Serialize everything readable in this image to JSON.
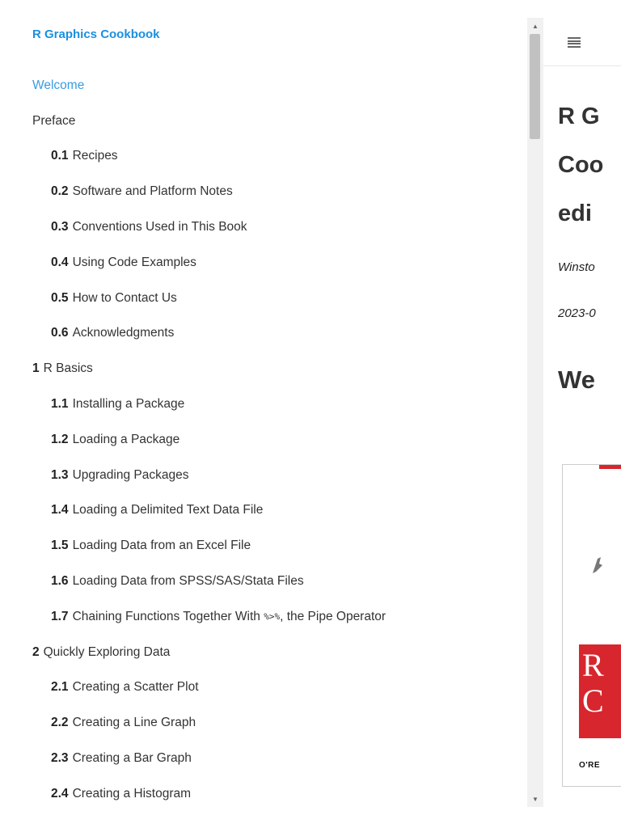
{
  "sidebar": {
    "book_title": "R Graphics Cookbook",
    "items": [
      {
        "num": "",
        "label": "Welcome",
        "level": 0,
        "active": true
      },
      {
        "num": "",
        "label": "Preface",
        "level": 0,
        "active": false
      },
      {
        "num": "0.1",
        "label": "Recipes",
        "level": 1,
        "active": false
      },
      {
        "num": "0.2",
        "label": "Software and Platform Notes",
        "level": 1,
        "active": false
      },
      {
        "num": "0.3",
        "label": "Conventions Used in This Book",
        "level": 1,
        "active": false
      },
      {
        "num": "0.4",
        "label": "Using Code Examples",
        "level": 1,
        "active": false
      },
      {
        "num": "0.5",
        "label": "How to Contact Us",
        "level": 1,
        "active": false
      },
      {
        "num": "0.6",
        "label": "Acknowledgments",
        "level": 1,
        "active": false
      },
      {
        "num": "1",
        "label": "R Basics",
        "level": 0,
        "active": false
      },
      {
        "num": "1.1",
        "label": "Installing a Package",
        "level": 1,
        "active": false
      },
      {
        "num": "1.2",
        "label": "Loading a Package",
        "level": 1,
        "active": false
      },
      {
        "num": "1.3",
        "label": "Upgrading Packages",
        "level": 1,
        "active": false
      },
      {
        "num": "1.4",
        "label": "Loading a Delimited Text Data File",
        "level": 1,
        "active": false
      },
      {
        "num": "1.5",
        "label": "Loading Data from an Excel File",
        "level": 1,
        "active": false
      },
      {
        "num": "1.6",
        "label": "Loading Data from SPSS/SAS/Stata Files",
        "level": 1,
        "active": false
      },
      {
        "num": "1.7",
        "label": "Chaining Functions Together With ",
        "code": "%>%",
        "label_after": ", the Pipe Operator",
        "level": 1,
        "active": false
      },
      {
        "num": "2",
        "label": "Quickly Exploring Data",
        "level": 0,
        "active": false
      },
      {
        "num": "2.1",
        "label": "Creating a Scatter Plot",
        "level": 1,
        "active": false
      },
      {
        "num": "2.2",
        "label": "Creating a Line Graph",
        "level": 1,
        "active": false
      },
      {
        "num": "2.3",
        "label": "Creating a Bar Graph",
        "level": 1,
        "active": false
      },
      {
        "num": "2.4",
        "label": "Creating a Histogram",
        "level": 1,
        "active": false
      }
    ]
  },
  "main": {
    "title_lines": [
      "R G",
      "Coo",
      "edi"
    ],
    "author": "Winsto",
    "date": "2023-0",
    "heading": "We",
    "cover": {
      "letters": "R\nC",
      "publisher": "O'RE"
    }
  },
  "icons": {
    "menu": "hamburger-menu-icon",
    "scroll_up": "scroll-up-arrow-icon",
    "scroll_down": "scroll-down-arrow-icon"
  },
  "colors": {
    "accent": "#1a8fe0",
    "active_link": "#3a9be0",
    "cover_red": "#d8262e"
  }
}
